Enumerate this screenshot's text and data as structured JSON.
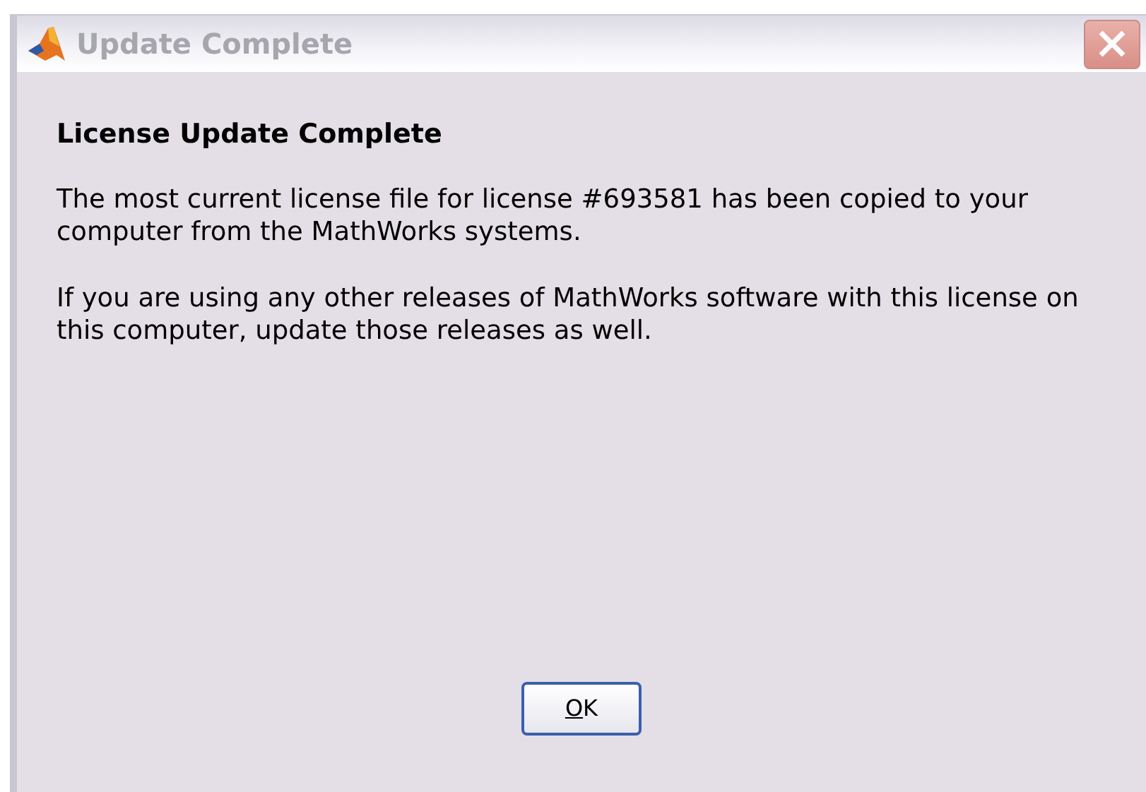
{
  "window": {
    "title": "Update Complete",
    "active": false
  },
  "heading": "License Update Complete",
  "paragraphs": [
    "The most current license file for license #693581 has been copied to your computer from the MathWorks systems.",
    "If you are using any other releases of MathWorks software with this license on this computer, update those releases as well."
  ],
  "buttons": [
    {
      "label": "OK",
      "mnemonic_underlined": true,
      "default": true
    }
  ]
}
